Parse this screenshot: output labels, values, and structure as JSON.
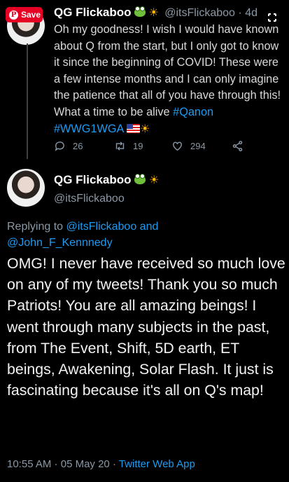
{
  "overlay": {
    "save_label": "Save",
    "pin_glyph": "P"
  },
  "tweet1": {
    "author_name": "QG Flickaboo",
    "handle": "@itsFlickaboo",
    "separator": "·",
    "time": "4d",
    "text_main": "Oh my goodness! I wish I would have known about Q from the start, but I only got to know it since the beginning of COVID! These were a few intense months and I can only imagine the patience that all of you have through this! What a time to be alive ",
    "hashtag1": "#Qanon",
    "hashtag2": "#WWG1WGA",
    "counts": {
      "replies": "26",
      "retweets": "19",
      "likes": "294"
    }
  },
  "tweet2": {
    "author_name": "QG Flickaboo",
    "handle": "@itsFlickaboo",
    "replying_prefix": "Replying to ",
    "reply_user1": "@itsFlickaboo",
    "reply_and": " and",
    "reply_user2": "@John_F_Kennnedy",
    "text": "OMG! I never have received so much love on any of my tweets! Thank you so much Patriots! You are all amazing beings! I went through many subjects in the past, from The Event, Shift, 5D earth, ET beings, Awakening, Solar Flash. It just is fascinating because it's all on Q's map!",
    "time": "10:55 AM",
    "dot": " · ",
    "date": "05 May 20",
    "dot2": " · ",
    "source": "Twitter Web App"
  },
  "icons": {
    "save": "pinterest-icon",
    "expand": "expand-icon",
    "reply": "reply-icon",
    "retweet": "retweet-icon",
    "like": "heart-icon",
    "share": "share-icon",
    "emoji_frog": "frog-emoji",
    "emoji_sun": "sun-emoji",
    "emoji_flag": "us-flag-emoji"
  },
  "colors": {
    "background": "#000000",
    "link": "#1d9bf0",
    "muted": "#8b98a5",
    "text": "#d9d9d9",
    "save_button": "#e60023"
  }
}
